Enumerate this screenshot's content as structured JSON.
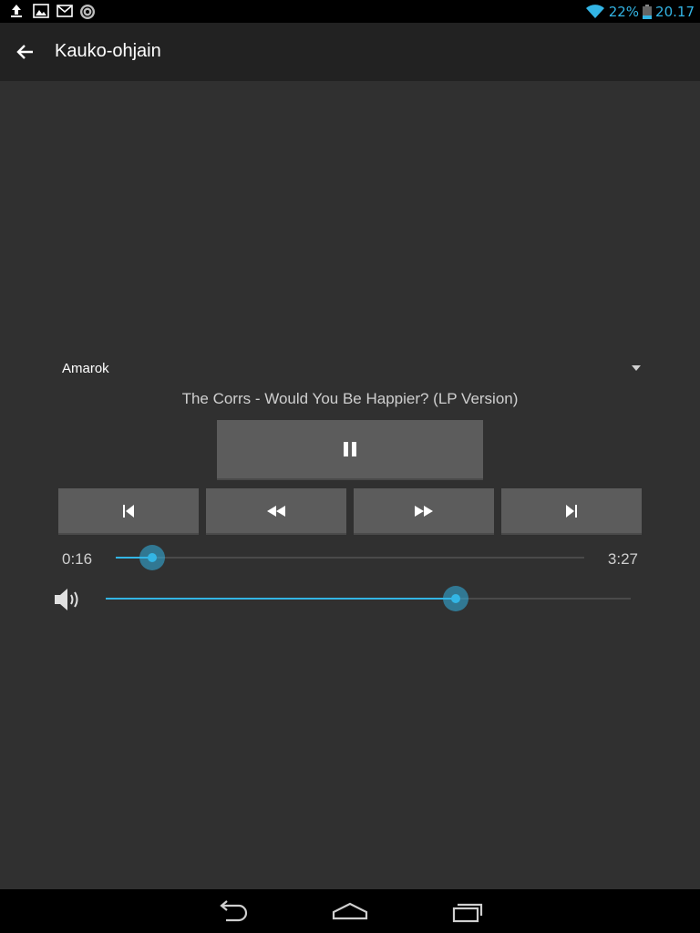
{
  "status_bar": {
    "notification_icons": [
      "upload-icon",
      "image-icon",
      "gmail-icon",
      "radio-icon"
    ],
    "battery_percent": "22%",
    "time": "20.17"
  },
  "action_bar": {
    "title": "Kauko-ohjain"
  },
  "player": {
    "selected": "Amarok"
  },
  "now_playing": {
    "title": "The Corrs - Would You Be Happier? (LP Version)"
  },
  "seek": {
    "elapsed": "0:16",
    "total": "3:27",
    "progress": 0.077
  },
  "volume": {
    "level": 0.667
  },
  "colors": {
    "accent": "#33b5e5",
    "background": "#303030",
    "button": "#5c5c5c"
  }
}
